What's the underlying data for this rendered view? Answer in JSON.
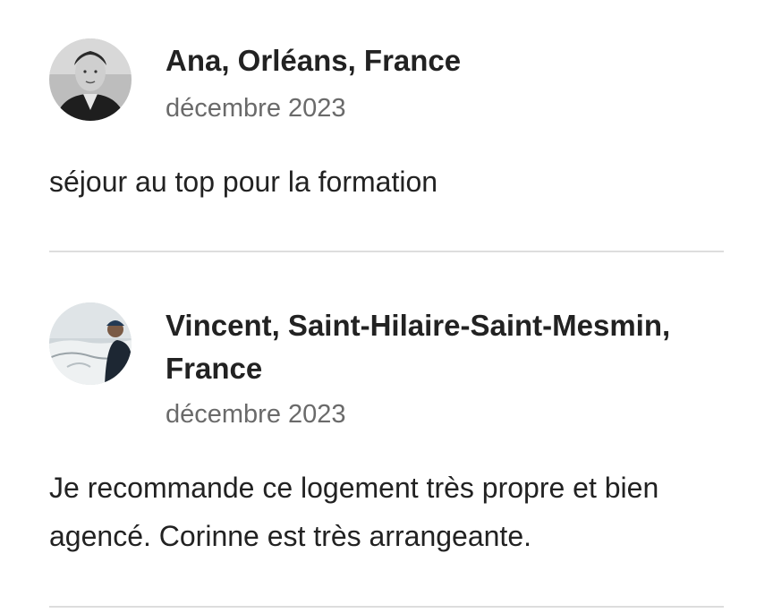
{
  "reviews": [
    {
      "name": "Ana, Orléans, France",
      "date": "décembre 2023",
      "text": "séjour au top pour la formation",
      "avatar_icon": "person-photo-avatar"
    },
    {
      "name": "Vincent, Saint-Hilaire-Saint-Mesmin, France",
      "date": "décembre 2023",
      "text": "Je recommande ce logement très propre et bien agencé. Corinne est très arrangeante.",
      "avatar_icon": "snow-landscape-avatar"
    }
  ]
}
